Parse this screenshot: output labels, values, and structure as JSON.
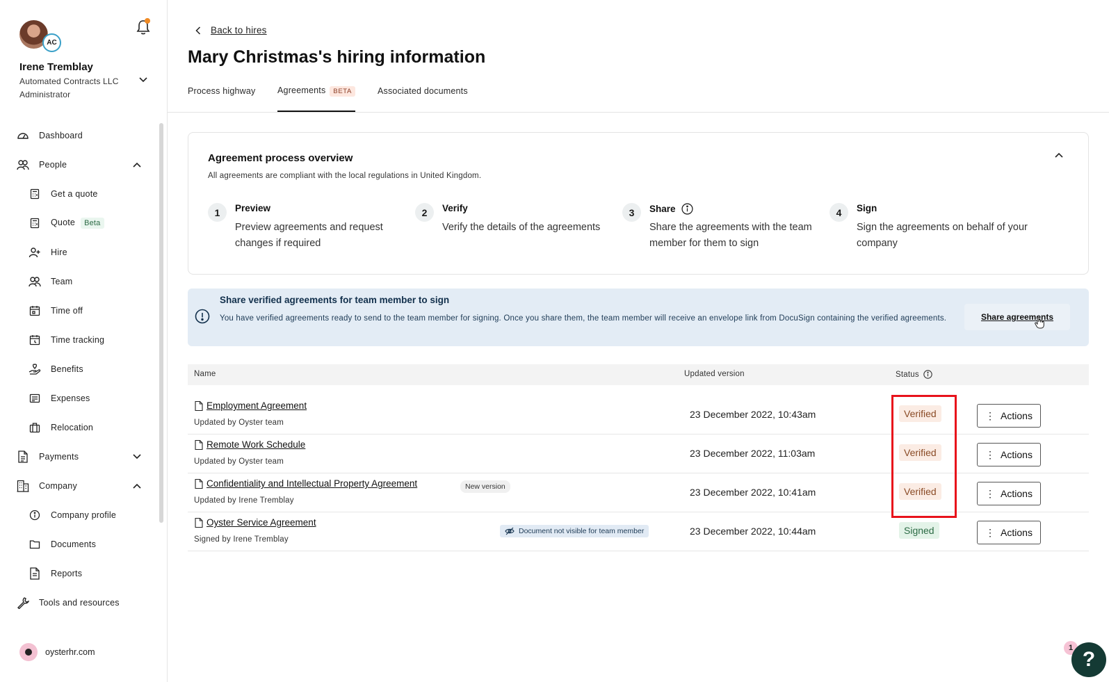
{
  "user": {
    "initials": "AC",
    "name": "Irene Tremblay",
    "company": "Automated Contracts LLC",
    "role": "Administrator"
  },
  "nav": {
    "dashboard": "Dashboard",
    "people": "People",
    "get_quote": "Get a quote",
    "quote": "Quote",
    "quote_badge": "Beta",
    "hire": "Hire",
    "team": "Team",
    "time_off": "Time off",
    "time_tracking": "Time tracking",
    "benefits": "Benefits",
    "expenses": "Expenses",
    "relocation": "Relocation",
    "payments": "Payments",
    "company": "Company",
    "company_profile": "Company profile",
    "documents": "Documents",
    "reports": "Reports",
    "tools": "Tools and resources"
  },
  "footer": {
    "site": "oysterhr.com"
  },
  "header": {
    "back_label": "Back to hires",
    "title": "Mary Christmas's hiring information"
  },
  "tabs": {
    "process": "Process highway",
    "agreements": "Agreements",
    "agreements_badge": "BETA",
    "documents": "Associated documents"
  },
  "overview": {
    "title": "Agreement process overview",
    "subtitle": "All agreements are compliant with the local regulations in United Kingdom.",
    "steps": [
      {
        "num": "1",
        "title": "Preview",
        "desc": "Preview agreements and request changes if required"
      },
      {
        "num": "2",
        "title": "Verify",
        "desc": "Verify the details of the agreements"
      },
      {
        "num": "3",
        "title": "Share",
        "desc": "Share the agreements with the team member for them to sign"
      },
      {
        "num": "4",
        "title": "Sign",
        "desc": "Sign the agreements on behalf of your company"
      }
    ]
  },
  "banner": {
    "title": "Share verified agreements for team member to sign",
    "text": "You have verified agreements ready to send to the team member for signing. Once you share them, the team member will receive an envelope link from DocuSign containing the verified agreements.",
    "button": "Share agreements"
  },
  "table": {
    "headers": {
      "name": "Name",
      "updated": "Updated version",
      "status": "Status"
    },
    "actions_label": "Actions",
    "rows": [
      {
        "name": "Employment Agreement",
        "by": "Updated by Oyster team",
        "updated": "23 December 2022, 10:43am",
        "status": "Verified"
      },
      {
        "name": "Remote Work Schedule",
        "by": "Updated by Oyster team",
        "updated": "23 December 2022, 11:03am",
        "status": "Verified"
      },
      {
        "name": "Confidentiality and Intellectual Property Agreement",
        "by": "Updated by Irene Tremblay",
        "updated": "23 December 2022, 10:41am",
        "status": "Verified",
        "chip": "New version"
      },
      {
        "name": "Oyster Service Agreement",
        "by": "Signed by Irene Tremblay",
        "updated": "23 December 2022, 10:44am",
        "status": "Signed",
        "chip": "Document not visible for team member"
      }
    ]
  },
  "help": {
    "badge": "1",
    "label": "?"
  },
  "colors": {
    "highlight": "#e8121b",
    "banner_bg": "#e3ecf5",
    "verified_bg": "#fbece4",
    "signed_bg": "#e3f3e8"
  }
}
